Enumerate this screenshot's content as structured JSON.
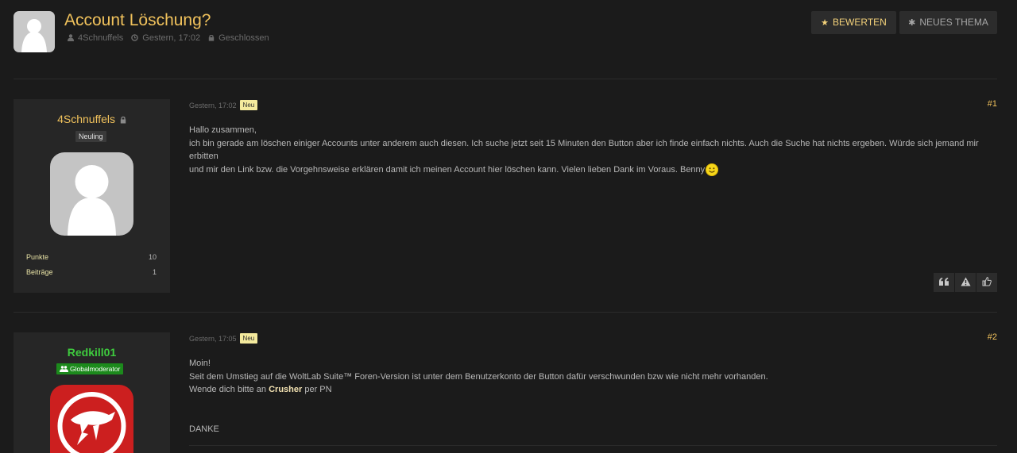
{
  "thread": {
    "title": "Account Löschung?",
    "author": "4Schnuffels",
    "date": "Gestern, 17:02",
    "status": "Geschlossen"
  },
  "toolbar": {
    "rate_label": "BEWERTEN",
    "new_thread_label": "NEUES THEMA"
  },
  "posts": [
    {
      "user": {
        "name": "4Schnuffels",
        "rank": "Neuling",
        "stats": [
          {
            "label": "Punkte",
            "value": "10"
          },
          {
            "label": "Beiträge",
            "value": "1"
          }
        ]
      },
      "date": "Gestern, 17:02",
      "badge": "Neu",
      "number": "#1",
      "lines": [
        "Hallo zusammen,",
        "ich bin gerade am löschen einiger Accounts unter anderem auch diesen. Ich suche jetzt seit 15 Minuten den Button aber ich finde einfach nichts. Auch die Suche hat nichts ergeben. Würde sich jemand mir erbitten",
        "und mir den Link bzw. die Vorgehnsweise erklären damit ich meinen Account hier löschen kann. Vielen lieben Dank im Voraus. Benny"
      ]
    },
    {
      "user": {
        "name": "Redkill01",
        "rank": "Globalmoderator"
      },
      "date": "Gestern, 17:05",
      "badge": "Neu",
      "number": "#2",
      "line1": "Moin!",
      "line2": "Seit dem Umstieg auf die WoltLab Suite™ Foren-Version ist unter dem Benutzerkonto der Button dafür verschwunden bzw wie nicht mehr vorhanden.",
      "line3_pre": "Wende dich bitte an ",
      "line3_mention": "Crusher",
      "line3_post": " per PN",
      "line4": "DANKE"
    }
  ],
  "colors": {
    "accent": "#f1c25c",
    "moderator": "#3ecb3e",
    "background": "#1b1b1b",
    "panel": "#262626"
  }
}
